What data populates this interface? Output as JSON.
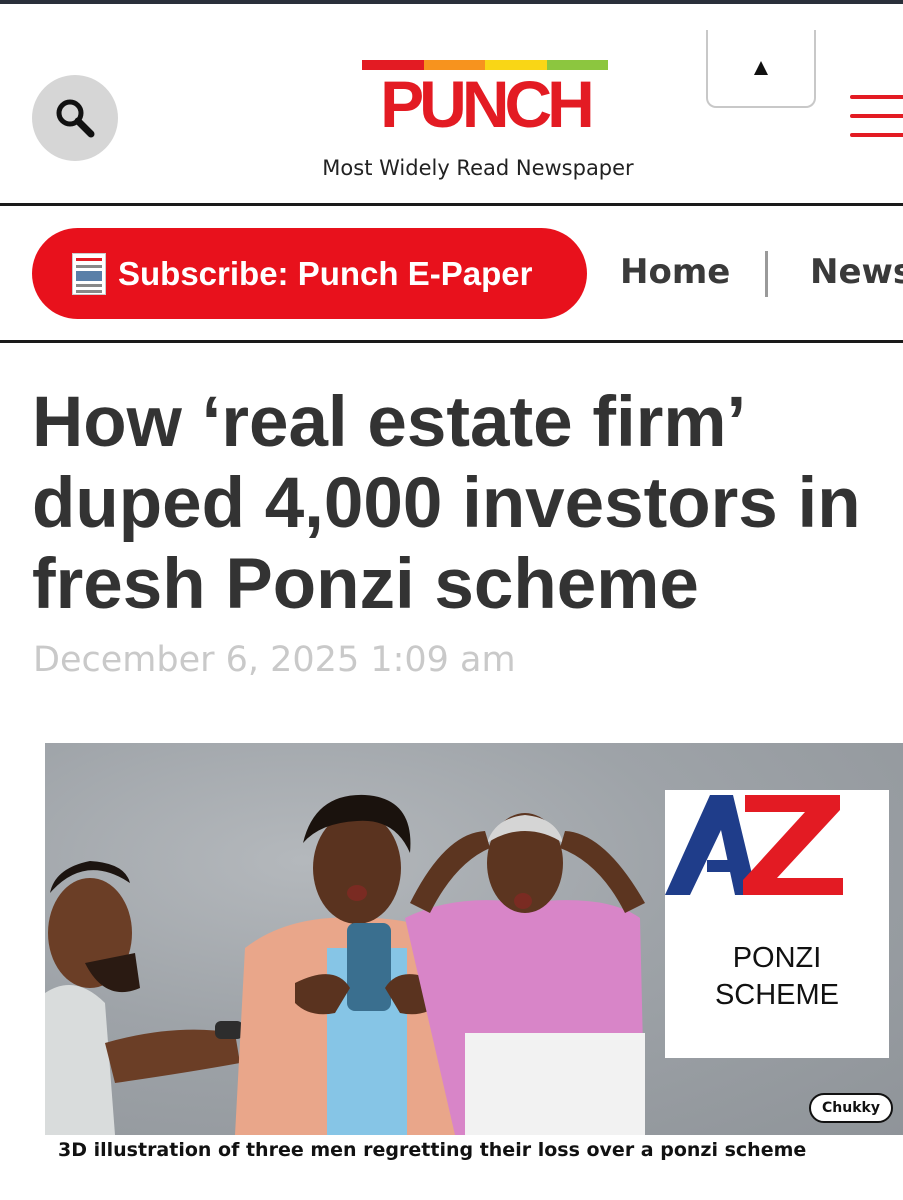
{
  "header": {
    "logo_text": "PUNCH",
    "tagline": "Most Widely Read Newspaper",
    "scroll_top_glyph": "▲",
    "logo_bar_colors": [
      "#e31b23",
      "#f7931e",
      "#f9d616",
      "#8cc63f"
    ]
  },
  "nav": {
    "subscribe_label": "Subscribe: Punch E-Paper",
    "items": [
      "Home",
      "News"
    ]
  },
  "article": {
    "headline_lines": [
      "How ‘real estate firm’",
      "duped 4,000 investors in",
      "fresh Ponzi scheme"
    ],
    "date": "December 6, 2025 1:09 am",
    "image": {
      "card_letters": "AZ",
      "card_caption_lines": [
        "PONZI",
        "SCHEME"
      ],
      "signature": "Chukky"
    },
    "caption": "3D illustration of three men regretting their loss over a ponzi scheme"
  },
  "icons": [
    "search-icon",
    "arrow-up-icon",
    "hamburger-menu-icon",
    "epaper-thumbnail-icon"
  ],
  "colors": {
    "brand_red": "#e31b23",
    "subscribe_red": "#e8111c",
    "headline": "#333333",
    "date_gray": "#c9c9c9"
  }
}
